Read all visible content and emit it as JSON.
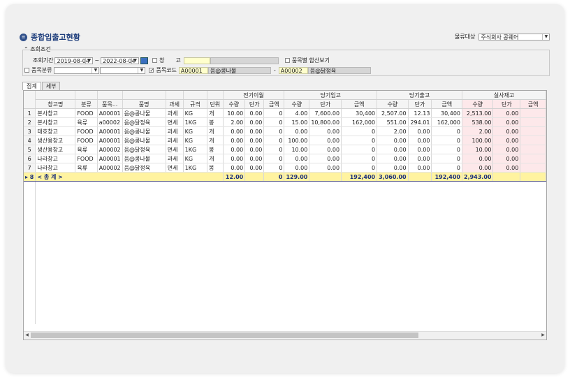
{
  "title": "종합입출고현황",
  "distribution": {
    "label": "물류대상",
    "value": "주식회사 콩웨어"
  },
  "conditions": {
    "label": "조회조건",
    "period_label": "조회기간",
    "date_from": "2019-08-04",
    "date_to": "2022-08-04",
    "tilde": "~",
    "warehouse_label": "창",
    "warehouse_label2": "고",
    "sum_by_item_label": "품목별 합산보기",
    "category_label": "품목분류",
    "item_code_label": "품목코드",
    "item_code_from": "A00001",
    "item_name_from": "음@콩나물",
    "dash": "-",
    "item_code_to": "A00002",
    "item_name_to": "음@닭정육"
  },
  "tabs": [
    {
      "label": "집계"
    },
    {
      "label": "세부"
    }
  ],
  "table": {
    "groups": [
      "전기이월",
      "당기입고",
      "당기출고",
      "실사재고"
    ],
    "headers": [
      "창고명",
      "분류",
      "품목...",
      "품명",
      "과세",
      "규격",
      "단위",
      "수량",
      "단가",
      "금액",
      "수량",
      "단가",
      "금액",
      "수량",
      "단가",
      "금액",
      "수량",
      "단가",
      "금액"
    ],
    "rows": [
      [
        "1",
        "본사창고",
        "FOOD",
        "A00001",
        "음@콩나물",
        "과세",
        "KG",
        "개",
        "10.00",
        "0.00",
        "0",
        "4.00",
        "7,600.00",
        "30,400",
        "2,507.00",
        "12.13",
        "30,400",
        "2,513.00",
        "0.00",
        ""
      ],
      [
        "2",
        "본사창고",
        "육류",
        "a00002",
        "음@닭정육",
        "면세",
        "1KG",
        "봉",
        "2.00",
        "0.00",
        "0",
        "15.00",
        "10,800.00",
        "162,000",
        "551.00",
        "294.01",
        "162,000",
        "538.00",
        "0.00",
        ""
      ],
      [
        "3",
        "태호창고",
        "FOOD",
        "A00001",
        "음@콩나물",
        "과세",
        "KG",
        "개",
        "0.00",
        "0.00",
        "0",
        "0.00",
        "0.00",
        "0",
        "2.00",
        "0.00",
        "0",
        "2.00",
        "0.00",
        ""
      ],
      [
        "4",
        "생산용창고",
        "FOOD",
        "A00001",
        "음@콩나물",
        "과세",
        "KG",
        "개",
        "0.00",
        "0.00",
        "0",
        "100.00",
        "0.00",
        "0",
        "0.00",
        "0.00",
        "0",
        "100.00",
        "0.00",
        ""
      ],
      [
        "5",
        "생산용창고",
        "육류",
        "A00002",
        "음@닭정육",
        "면세",
        "1KG",
        "봉",
        "0.00",
        "0.00",
        "0",
        "10.00",
        "0.00",
        "0",
        "0.00",
        "0.00",
        "0",
        "10.00",
        "0.00",
        ""
      ],
      [
        "6",
        "나라창고",
        "FOOD",
        "A00001",
        "음@콩나물",
        "과세",
        "KG",
        "개",
        "0.00",
        "0.00",
        "0",
        "0.00",
        "0.00",
        "0",
        "0.00",
        "0.00",
        "0",
        "0.00",
        "0.00",
        ""
      ],
      [
        "7",
        "나라창고",
        "육류",
        "A00002",
        "음@닭정육",
        "면세",
        "1KG",
        "봉",
        "0.00",
        "0.00",
        "0",
        "0.00",
        "0.00",
        "0",
        "0.00",
        "0.00",
        "0",
        "0.00",
        "0.00",
        ""
      ]
    ],
    "total": {
      "marker": "▸ 8",
      "label": "< 총 계 >",
      "values": [
        "12.00",
        "",
        "0",
        "129.00",
        "",
        "192,400",
        "3,060.00",
        "",
        "192,400",
        "2,943.00",
        "",
        ""
      ]
    }
  },
  "colors": {
    "title": "#1b3b7a",
    "total_row": "#fff3a0",
    "stock_cols": "#fde8ea"
  }
}
